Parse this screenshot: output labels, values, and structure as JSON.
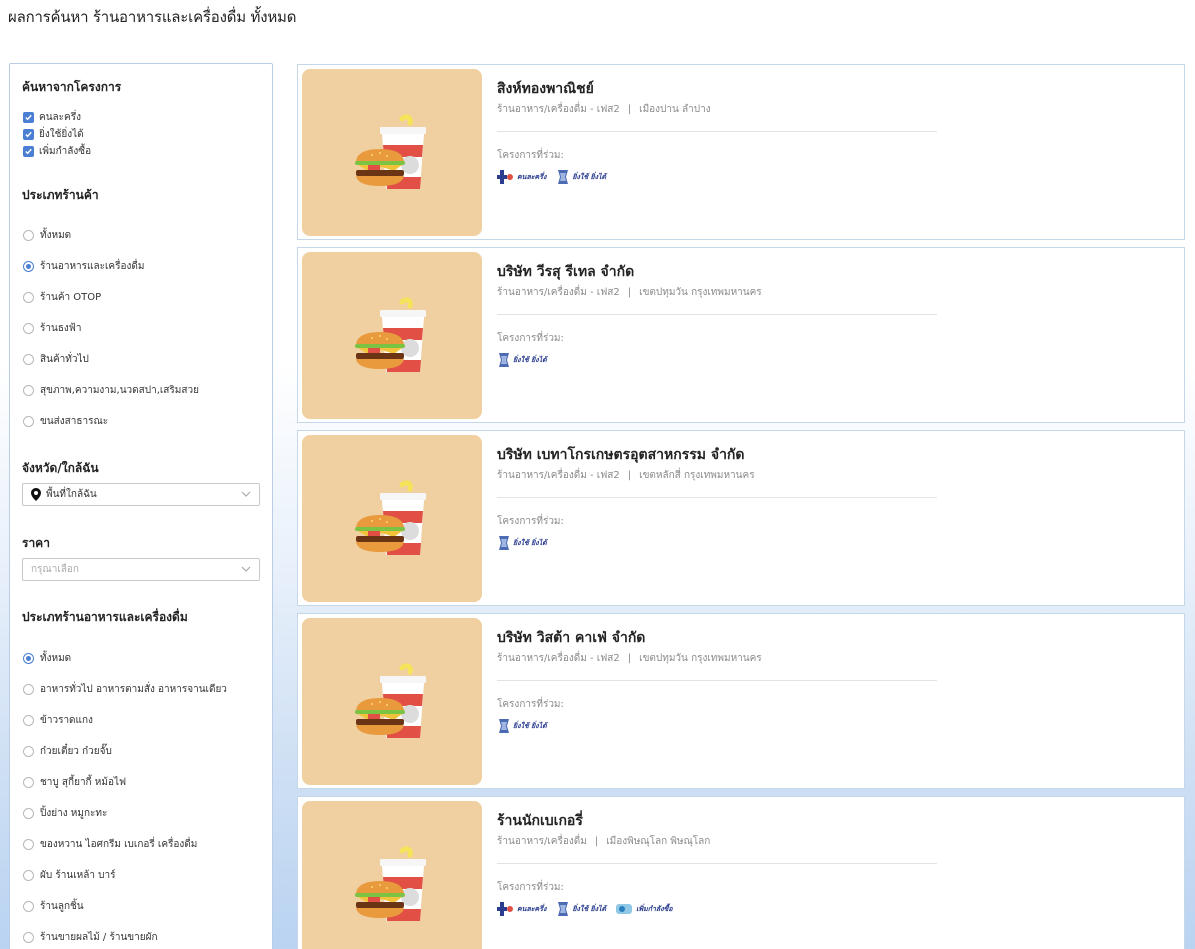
{
  "page": {
    "title": "ผลการค้นหา ร้านอาหารและเครื่องดื่ม ทั้งหมด"
  },
  "sidebar": {
    "projects": {
      "title": "ค้นหาจากโครงการ",
      "items": [
        {
          "label": "คนละครึ่ง",
          "checked": true
        },
        {
          "label": "ยิ่งใช้ยิ่งได้",
          "checked": true
        },
        {
          "label": "เพิ่มกำลังซื้อ",
          "checked": true
        }
      ]
    },
    "store_type": {
      "title": "ประเภทร้านค้า",
      "options": [
        {
          "label": "ทั้งหมด",
          "selected": false
        },
        {
          "label": "ร้านอาหารและเครื่องดื่ม",
          "selected": true
        },
        {
          "label": "ร้านค้า OTOP",
          "selected": false
        },
        {
          "label": "ร้านธงฟ้า",
          "selected": false
        },
        {
          "label": "สินค้าทั่วไป",
          "selected": false
        },
        {
          "label": "สุขภาพ,ความงาม,นวดสปา,เสริมสวย",
          "selected": false
        },
        {
          "label": "ขนส่งสาธารณะ",
          "selected": false
        }
      ]
    },
    "province": {
      "title": "จังหวัด/ใกล้ฉัน",
      "value": "พื้นที่ใกล้ฉัน",
      "icon": "map-pin-icon"
    },
    "price": {
      "title": "ราคา",
      "placeholder": "กรุณาเลือก"
    },
    "food_type": {
      "title": "ประเภทร้านอาหารและเครื่องดื่ม",
      "options": [
        {
          "label": "ทั้งหมด",
          "selected": true
        },
        {
          "label": "อาหารทั่วไป อาหารตามสั่ง อาหารจานเดียว",
          "selected": false
        },
        {
          "label": "ข้าวราดแกง",
          "selected": false
        },
        {
          "label": "ก๋วยเตี๋ยว ก๋วยจั๊บ",
          "selected": false
        },
        {
          "label": "ชาบู สุกี้ยากี้ หม้อไฟ",
          "selected": false
        },
        {
          "label": "ปิ้งย่าง หมูกะทะ",
          "selected": false
        },
        {
          "label": "ของหวาน ไอศกรีม เบเกอรี่ เครื่องดื่ม",
          "selected": false
        },
        {
          "label": "ผับ ร้านเหล้า บาร์",
          "selected": false
        },
        {
          "label": "ร้านลูกชิ้น",
          "selected": false
        },
        {
          "label": "ร้านขายผลไม้ / ร้านขายผัก",
          "selected": false
        }
      ]
    }
  },
  "results": [
    {
      "name": "สิงห์ทองพาณิชย์",
      "category": "ร้านอาหาร/เครื่องดื่ม - เฟส2",
      "location": "เมืองปาน ลำปาง",
      "projects_label": "โครงการที่ร่วม:",
      "projects": [
        "คนละครึ่ง",
        "ยิ่งใช้ ยิ่งได้"
      ]
    },
    {
      "name": "บริษัท วีรสุ รีเทล จำกัด",
      "category": "ร้านอาหาร/เครื่องดื่ม - เฟส2",
      "location": "เขตปทุมวัน กรุงเทพมหานคร",
      "projects_label": "โครงการที่ร่วม:",
      "projects": [
        "ยิ่งใช้ ยิ่งได้"
      ]
    },
    {
      "name": "บริษัท เบทาโกรเกษตรอุตสาหกรรม จำกัด",
      "category": "ร้านอาหาร/เครื่องดื่ม - เฟส2",
      "location": "เขตหลักสี่ กรุงเทพมหานคร",
      "projects_label": "โครงการที่ร่วม:",
      "projects": [
        "ยิ่งใช้ ยิ่งได้"
      ]
    },
    {
      "name": "บริษัท วิสต้า คาเฟ่ จำกัด",
      "category": "ร้านอาหาร/เครื่องดื่ม - เฟส2",
      "location": "เขตปทุมวัน กรุงเทพมหานคร",
      "projects_label": "โครงการที่ร่วม:",
      "projects": [
        "ยิ่งใช้ ยิ่งได้"
      ]
    },
    {
      "name": "ร้านนักเบเกอรี่",
      "category": "ร้านอาหาร/เครื่องดื่ม",
      "location": "เมืองพิษณุโลก พิษณุโลก",
      "projects_label": "โครงการที่ร่วม:",
      "projects": [
        "คนละครึ่ง",
        "ยิ่งใช้ ยิ่งได้",
        "เพิ่มกำลังซื้อ"
      ]
    }
  ],
  "colors": {
    "accent": "#4a7fd4",
    "thumb_bg": "#f0cfa0",
    "border": "#c5d8ea"
  }
}
